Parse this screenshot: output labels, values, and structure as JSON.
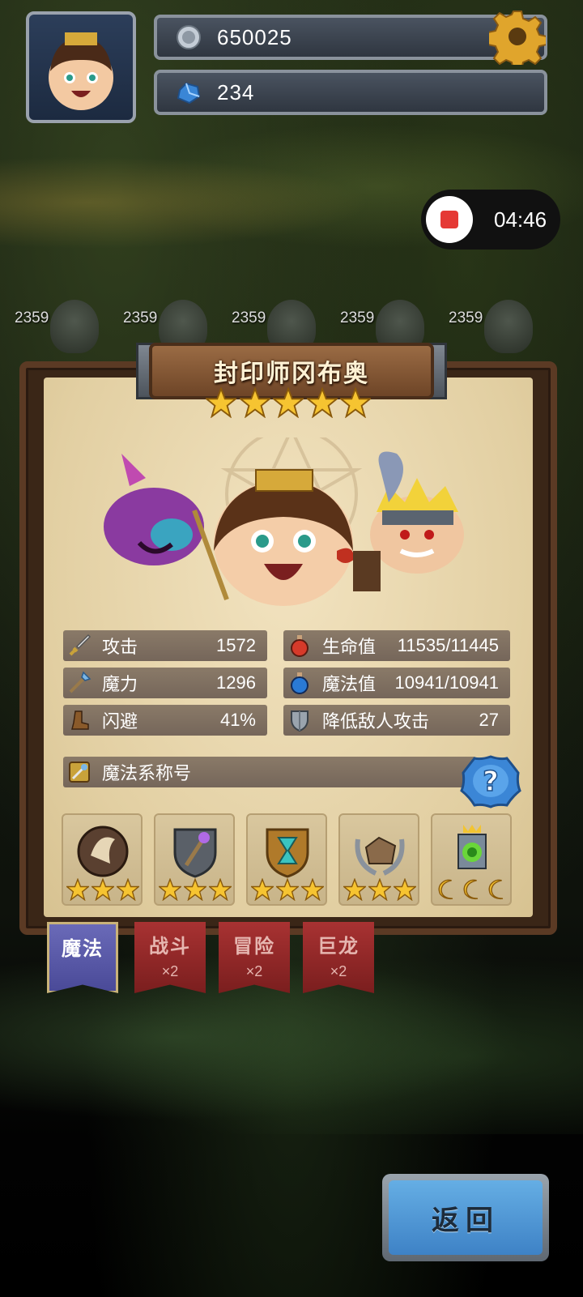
{
  "hud": {
    "coins": "650025",
    "gems": "234"
  },
  "recording": {
    "time": "04:46"
  },
  "enemies": [
    {
      "hp": "2359"
    },
    {
      "hp": "2359"
    },
    {
      "hp": "2359"
    },
    {
      "hp": "2359"
    },
    {
      "hp": "2359"
    }
  ],
  "hero": {
    "name": "封印师冈布奥",
    "stars": 5
  },
  "stats": {
    "attack": {
      "label": "攻击",
      "value": "1572"
    },
    "magic": {
      "label": "魔力",
      "value": "1296"
    },
    "dodge": {
      "label": "闪避",
      "value": "41%"
    },
    "hp": {
      "label": "生命值",
      "value": "11535/11445"
    },
    "mp": {
      "label": "魔法值",
      "value": "10941/10941"
    },
    "reduce": {
      "label": "降低敌人攻击",
      "value": "27"
    },
    "title": {
      "label": "魔法系称号"
    }
  },
  "skills": [
    {
      "name": "skill-1",
      "stars": 3,
      "star_style": "star"
    },
    {
      "name": "skill-2",
      "stars": 3,
      "star_style": "star"
    },
    {
      "name": "skill-3",
      "stars": 3,
      "star_style": "star"
    },
    {
      "name": "skill-4",
      "stars": 3,
      "star_style": "star"
    },
    {
      "name": "skill-5",
      "stars": 3,
      "star_style": "moon"
    }
  ],
  "tabs": [
    {
      "label": "魔法",
      "mult": ""
    },
    {
      "label": "战斗",
      "mult": "×2"
    },
    {
      "label": "冒险",
      "mult": "×2"
    },
    {
      "label": "巨龙",
      "mult": "×2"
    }
  ],
  "return_label": "返回",
  "colors": {
    "star_gold": "#f6c431",
    "tab_active": "#5a5aa8",
    "tab_inactive": "#8e2a2a",
    "return_blue": "#4f97d6"
  }
}
